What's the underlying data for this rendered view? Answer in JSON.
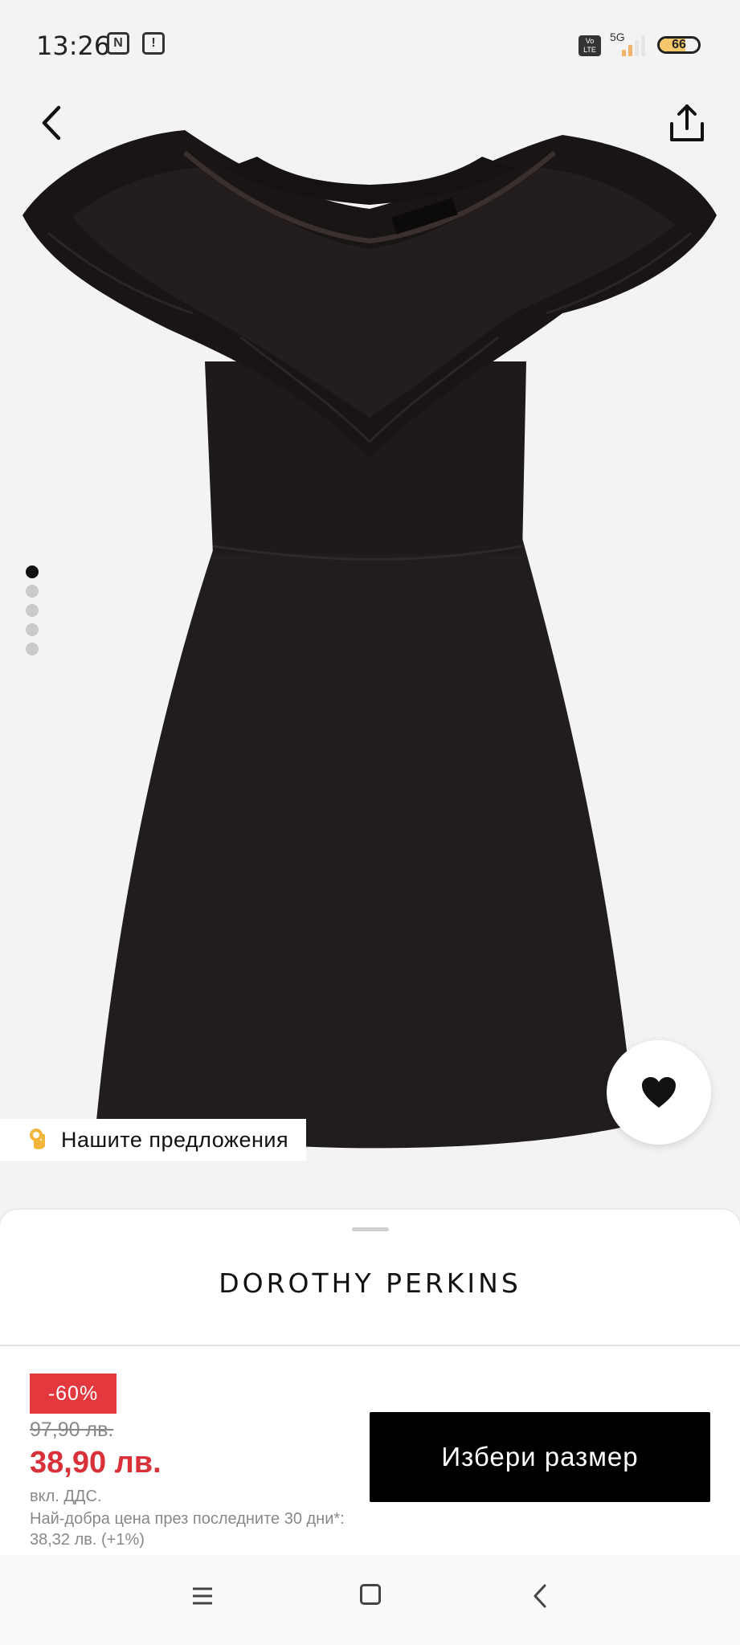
{
  "status_bar": {
    "time": "13:26",
    "nfc_icon": "nfc-icon",
    "sim_icon": "sim-icon",
    "volte": "Vo LTE",
    "network": "5G",
    "battery": "66",
    "battery_fraction": 0.66
  },
  "header": {
    "back_icon": "chevron-left-icon",
    "share_icon": "share-icon"
  },
  "gallery": {
    "product_icon": "black-ruffle-dress-image",
    "image_count": 5,
    "active_index": 0,
    "favorite_icon": "heart-icon"
  },
  "suggestions": {
    "emoji": "ok-hand-emoji",
    "label": "Нашите предложения"
  },
  "product": {
    "brand": "DOROTHY PERKINS",
    "discount": "-60%",
    "old_price": "97,90 лв.",
    "price": "38,90 лв.",
    "vat_note": "вкл. ДДС.",
    "best_price_note": "Най-добра цена през последните 30 дни*: 38,32 лв. (+1%)",
    "select_size_label": "Избери размер"
  },
  "colors": {
    "accent_red": "#e3383e",
    "price_red": "#d8313a",
    "button_black": "#000000"
  },
  "nav_bar": {
    "menu_icon": "menu-icon",
    "home_icon": "home-icon",
    "back_icon": "back-icon"
  }
}
